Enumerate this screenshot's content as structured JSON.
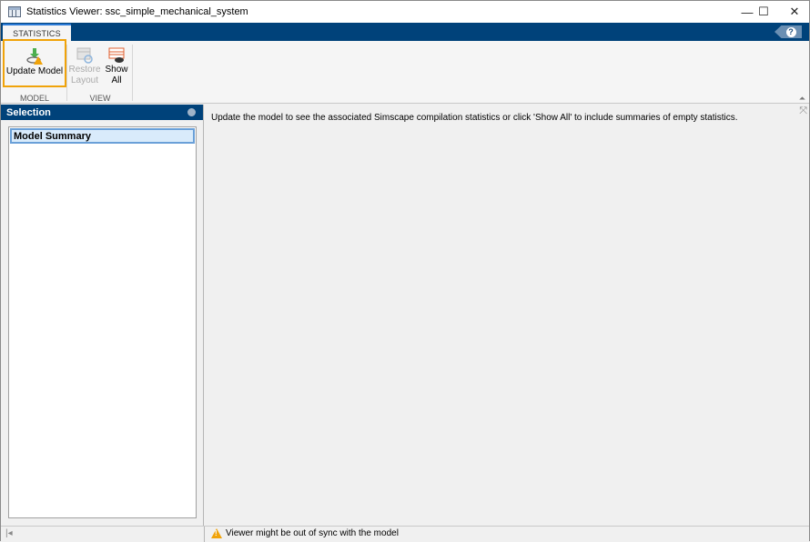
{
  "window": {
    "title": "Statistics Viewer: ssc_simple_mechanical_system",
    "minimize": "—",
    "maximize": "☐",
    "close": "✕"
  },
  "tabs": [
    {
      "label": "STATISTICS"
    }
  ],
  "help": {
    "label": "?"
  },
  "ribbon": {
    "model_group": {
      "label": "MODEL",
      "update_model": "Update Model"
    },
    "view_group": {
      "label": "VIEW",
      "restore_layout_line1": "Restore",
      "restore_layout_line2": "Layout",
      "show_all_line1": "Show",
      "show_all_line2": "All"
    },
    "collapse": "⏶"
  },
  "selection": {
    "title": "Selection",
    "items": [
      {
        "label": "Model Summary"
      }
    ]
  },
  "main": {
    "message": "Update the model to see the associated Simscape compilation statistics or click 'Show All' to include summaries of empty statistics."
  },
  "status": {
    "left_icon": "|◂",
    "message": "Viewer might be out of sync with the model"
  },
  "colors": {
    "accent": "#00427a",
    "highlight": "#f0a30a",
    "selection": "#d9ebfb"
  }
}
